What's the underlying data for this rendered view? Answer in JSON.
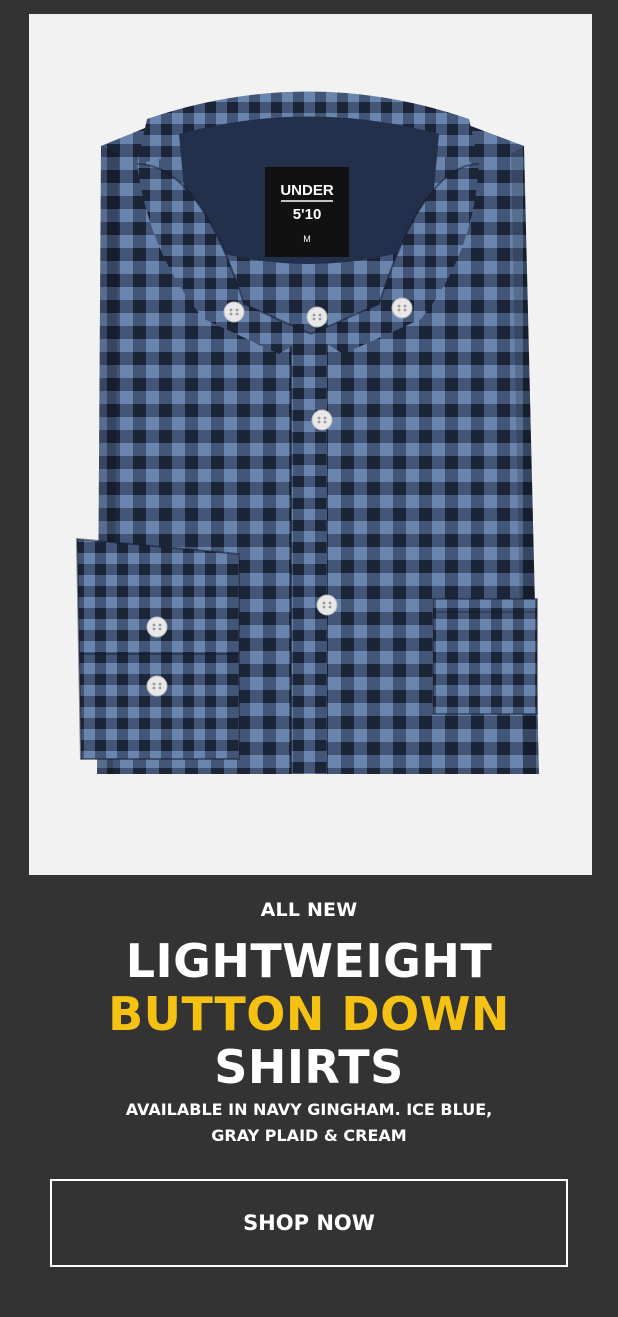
{
  "hero": {
    "brand_label_line1": "UNDER",
    "brand_label_line2": "5'10",
    "size_label": "M"
  },
  "promo": {
    "kicker": "ALL NEW",
    "headline_line1": "LIGHTWEIGHT",
    "headline_line2": "BUTTON DOWN",
    "headline_line3": "SHIRTS",
    "subtext_line1": "AVAILABLE IN NAVY GINGHAM. ICE BLUE,",
    "subtext_line2": "GRAY PLAID & CREAM",
    "cta_label": "SHOP NOW"
  },
  "colors": {
    "background": "#333333",
    "image_background": "#f2f2f2",
    "headline_white": "#ffffff",
    "headline_accent": "#f5c112",
    "shirt_dark": "#1c2438",
    "shirt_light": "#6a85ad"
  }
}
